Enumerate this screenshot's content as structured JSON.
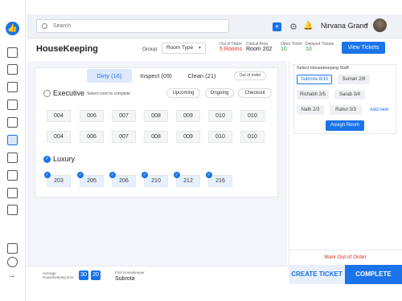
{
  "search": {
    "placeholder": "Search"
  },
  "header": {
    "hotel_name": "Nirvana Grand"
  },
  "page": {
    "title": "HouseKeeping",
    "group_label": "Group:",
    "group_value": "Room Type",
    "view_tickets_label": "View Tickets"
  },
  "stats": [
    {
      "label": "Out of Order",
      "value": "5 Rooms",
      "color": "#d93025"
    },
    {
      "label": "Critical Area",
      "value": "Room 202",
      "color": "#222222"
    },
    {
      "label": "Open Ticket",
      "value": "10",
      "color": "#1e9e4a"
    },
    {
      "label": "Delayed Tickets",
      "value": "10",
      "color": "#1e9e4a"
    }
  ],
  "tabs": [
    {
      "label": "Dirty (16)",
      "active": true
    },
    {
      "label": "Inspect (09)",
      "active": false
    },
    {
      "label": "Clean (21)",
      "active": false
    }
  ],
  "out_of_order_label": "Out of order",
  "executive": {
    "title": "Executive",
    "subtitle": "Select room to complete",
    "filters": [
      "Upcoming",
      "Ongoing",
      "Checkout"
    ],
    "rooms_row1": [
      "004",
      "006",
      "007",
      "008",
      "009",
      "010",
      "010"
    ],
    "rooms_row2": [
      "004",
      "006",
      "007",
      "008",
      "009",
      "010",
      "010"
    ]
  },
  "luxury": {
    "title": "Luxury",
    "rooms": [
      "203",
      "205",
      "206",
      "210",
      "212",
      "216"
    ]
  },
  "staff_panel": {
    "title": "Select Housekeeping Staff",
    "staff": [
      {
        "label": "Subrota 8/10",
        "selected": true
      },
      {
        "label": "Suman 2/6",
        "selected": false
      },
      {
        "label": "Rishabh 3/5",
        "selected": false
      },
      {
        "label": "Sarab 3/4",
        "selected": false
      },
      {
        "label": "Nath 2/3",
        "selected": false
      },
      {
        "label": "Rahul 3/3",
        "selected": false
      }
    ],
    "add_new_label": "Add new",
    "assign_label": "Assign Room"
  },
  "mark_out_label": "Mark Out of Order",
  "bottom": {
    "avg_label": "Average Housekeeping time",
    "avg_min": "30",
    "avg_sec": "20",
    "first_hk_label": "First Housekeeper",
    "first_hk_value": "Subrota"
  },
  "actions": {
    "create_ticket": "CREATE TICKET",
    "complete": "COMPLETE"
  },
  "colors": {
    "accent": "#1a73e8",
    "danger": "#d93025",
    "success": "#1e9e4a"
  }
}
